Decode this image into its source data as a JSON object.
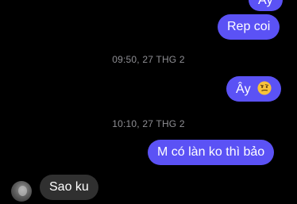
{
  "messages": {
    "top_partial": "Ây",
    "rep_coi": "Rep coi",
    "ts1": "09:50, 27 THG 2",
    "ay": "Ây",
    "ts2": "10:10, 27 THG 2",
    "m_co_lan": "M có làn ko thì bảo",
    "sao_ku": "Sao ku"
  },
  "colors": {
    "background": "#000000",
    "outgoing_bubble": "#5b52f5",
    "incoming_bubble": "#303030",
    "timestamp_text": "#8e8e93"
  },
  "icons": {
    "emoji": "skeptical-face-emoji",
    "avatar": "contact-avatar"
  }
}
